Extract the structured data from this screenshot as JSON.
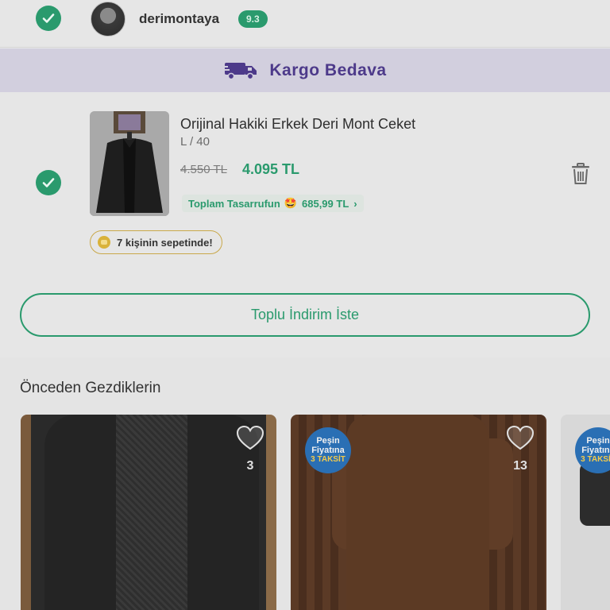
{
  "seller": {
    "name": "derimontaya",
    "rating": "9.3",
    "selected": true
  },
  "cargo_banner": {
    "text": "Kargo Bedava",
    "icon": "truck-icon"
  },
  "cart_item": {
    "selected": true,
    "title": "Orijinal Hakiki Erkek Deri Mont Ceket",
    "variant": "L / 40",
    "old_price": "4.550 TL",
    "new_price": "4.095 TL",
    "savings_label": "Toplam Tasarrufun",
    "savings_emoji": "🤩",
    "savings_amount": "685,99 TL",
    "savings_chevron": "›",
    "basket_count_text": "7 kişinin sepetinde!",
    "delete_icon": "trash-icon"
  },
  "bulk_discount_button": "Toplu İndirim İste",
  "recently_viewed": {
    "title": "Önceden Gezdiklerin",
    "items": [
      {
        "favorites": "3",
        "promo": null
      },
      {
        "favorites": "13",
        "promo": {
          "line1": "Peşin",
          "line2": "Fiyatına",
          "line3": "3 TAKSİT"
        }
      },
      {
        "favorites": "",
        "promo": {
          "line1": "Peşin",
          "line2": "Fiyatına",
          "line3": "3 TAKSİT"
        }
      }
    ]
  },
  "colors": {
    "accent_green": "#2a9a6d",
    "cargo_purple": "#4d3a8a",
    "cargo_bg": "#d2cfde",
    "promo_blue": "#2a6fb4"
  }
}
